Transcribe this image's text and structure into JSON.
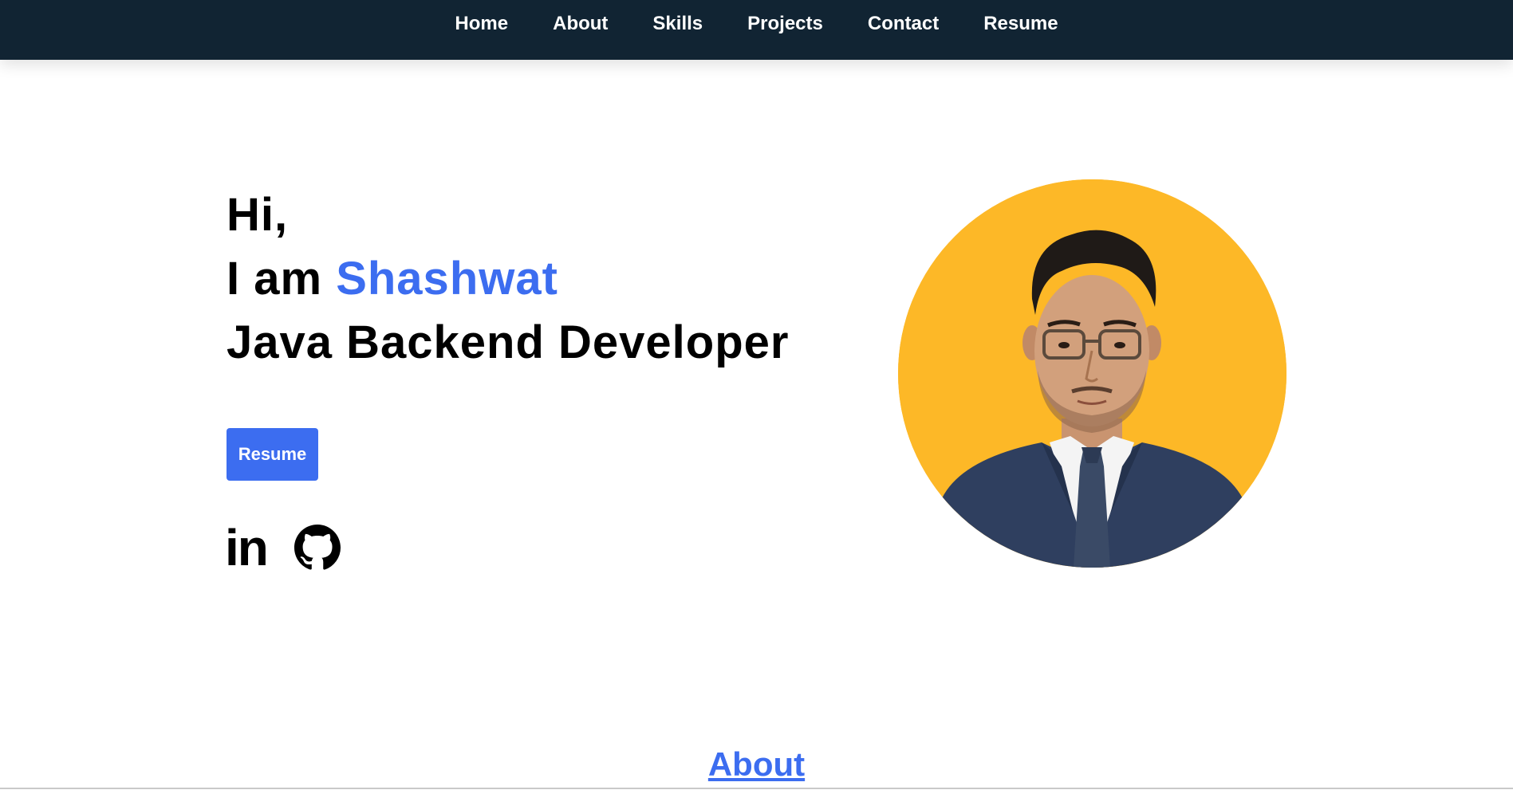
{
  "nav": {
    "items": [
      {
        "label": "Home"
      },
      {
        "label": "About"
      },
      {
        "label": "Skills"
      },
      {
        "label": "Projects"
      },
      {
        "label": "Contact"
      },
      {
        "label": "Resume"
      }
    ]
  },
  "hero": {
    "greeting": "Hi,",
    "intro_prefix": "I am",
    "name": "Shashwat",
    "role": "Java Backend Developer",
    "resume_button": "Resume",
    "social": {
      "linkedin_text": "in",
      "linkedin_icon": "linkedin-icon",
      "github_icon": "github-icon"
    }
  },
  "about": {
    "heading": "About"
  },
  "colors": {
    "navbar_bg": "#112433",
    "accent": "#3c6df0",
    "portrait_bg": "#fdb827",
    "text": "#000000"
  }
}
